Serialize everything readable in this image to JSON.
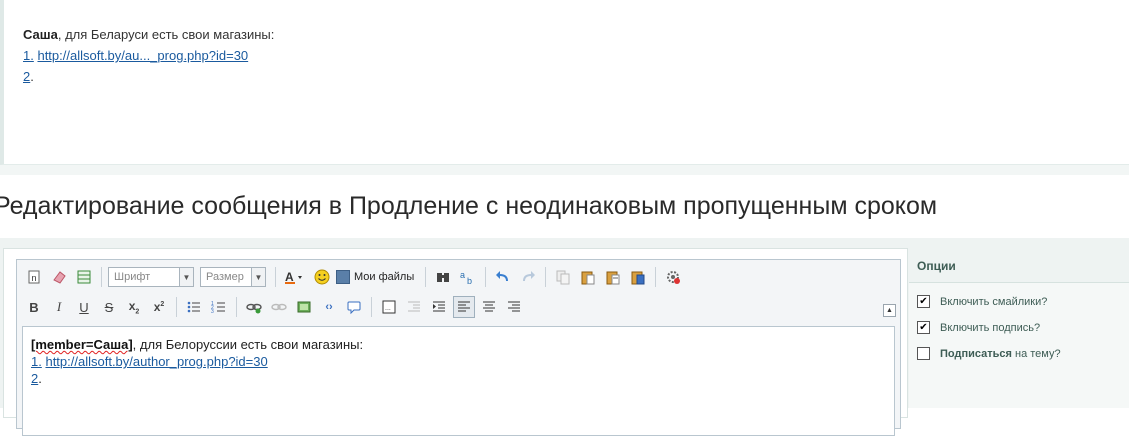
{
  "quote": {
    "author": "Саша",
    "text": ", для Беларуси есть свои магазины:",
    "link1_num": "1.",
    "link1_url": "http://allsoft.by/au..._prog.php?id=30",
    "link2_num": "2",
    "link2_dot": "."
  },
  "page_title": "Редактирование сообщения в Продление с неодинаковым пропущенным сроком",
  "toolbar": {
    "font_select": "Шрифт",
    "size_select": "Размер",
    "my_files": "Мои файлы"
  },
  "editor": {
    "member_tag": "[member=Саша]",
    "text": ", для Белоруссии есть свои магазины:",
    "link1_num": "1.",
    "link1_url": "http://allsoft.by/author_prog.php?id=30",
    "link2_num": "2",
    "link2_dot": "."
  },
  "options": {
    "title": "Опции",
    "smilies": {
      "label": "Включить смайлики?",
      "checked": true
    },
    "signature": {
      "label": "Включить подпись?",
      "checked": true
    },
    "subscribe": {
      "label_bold": "Подписаться",
      "label_rest": " на тему?",
      "checked": false
    }
  }
}
